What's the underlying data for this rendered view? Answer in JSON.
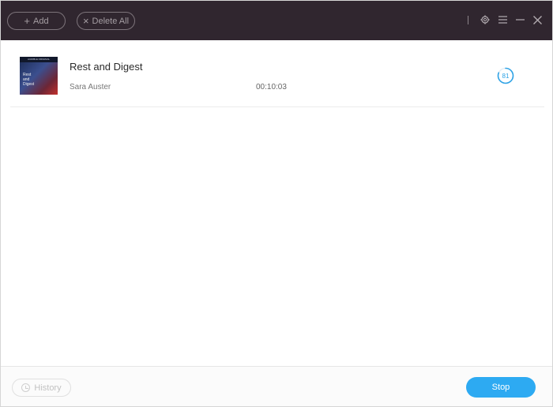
{
  "toolbar": {
    "add_label": "Add",
    "delete_all_label": "Delete All"
  },
  "icons": {
    "add": "plus-icon",
    "delete_all": "close-icon",
    "settings": "gear-icon",
    "menu": "hamburger-menu-icon",
    "minimize": "minimize-icon",
    "close": "close-icon",
    "history": "clock-icon"
  },
  "tasks": [
    {
      "title": "Rest and Digest",
      "author": "Sara Auster",
      "duration": "00:10:03",
      "progress": 81,
      "progress_label": "81",
      "cover": {
        "top_text": "AUDIBLE ORIGINAL",
        "lines": [
          "Rest",
          "and",
          "Digest"
        ]
      }
    }
  ],
  "footer": {
    "history_label": "History",
    "stop_label": "Stop"
  },
  "colors": {
    "titlebar": "#30262f",
    "accent": "#2daaf2",
    "progress": "#2fa3e6"
  }
}
